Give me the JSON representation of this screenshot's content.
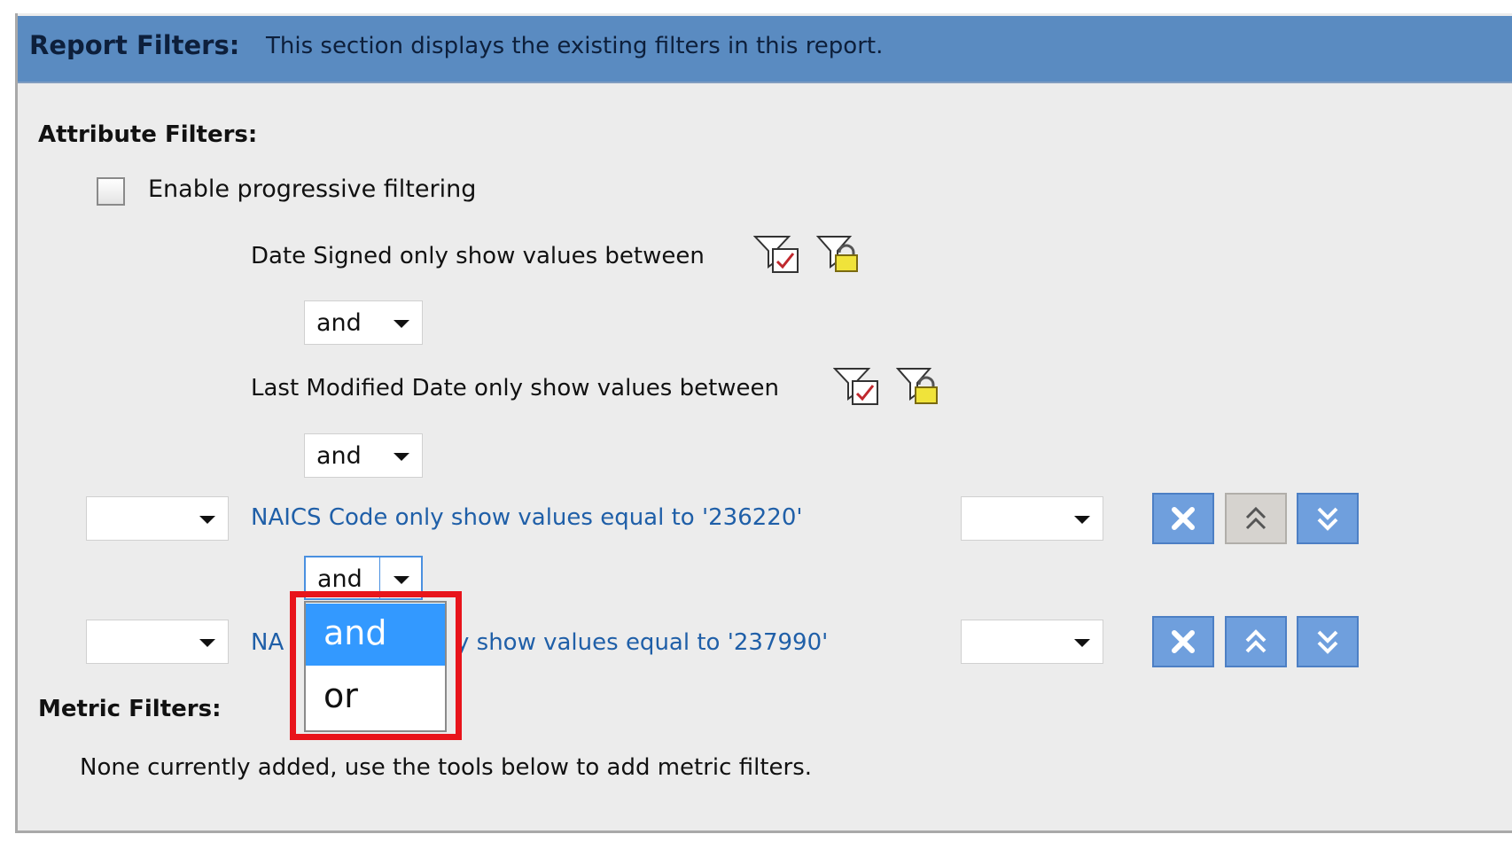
{
  "header": {
    "title": "Report Filters:",
    "description": "This section displays the existing filters in this report."
  },
  "attribute_filters": {
    "label": "Attribute Filters:",
    "progressive_label": "Enable progressive filtering",
    "progressive_checked": false,
    "filters": [
      {
        "text": "Date Signed only show values between",
        "style": "plain"
      },
      {
        "text": "Last Modified Date only show values between",
        "style": "plain"
      },
      {
        "text": "NAICS Code only show values equal to '236220'",
        "style": "link"
      },
      {
        "text_left": "NA",
        "text_right": "y show values equal to '237990'",
        "style": "link"
      }
    ],
    "operators": [
      "and",
      "and",
      "and"
    ]
  },
  "operator_dropdown": {
    "options": [
      "and",
      "or"
    ],
    "selected": "and"
  },
  "metric_filters": {
    "label": "Metric Filters:",
    "empty_text": "None currently added, use the tools below to add metric filters."
  },
  "icons": {
    "filter_edit": "filter-edit-icon",
    "filter_lock": "filter-lock-icon",
    "remove": "remove-icon",
    "move_up": "move-up-icon",
    "move_down": "move-down-icon"
  },
  "colors": {
    "header_bg": "#5a8bc1",
    "link": "#1f5fa8",
    "button": "#6f9fdd",
    "dropdown_selected": "#3399ff",
    "highlight": "#e8141b"
  }
}
